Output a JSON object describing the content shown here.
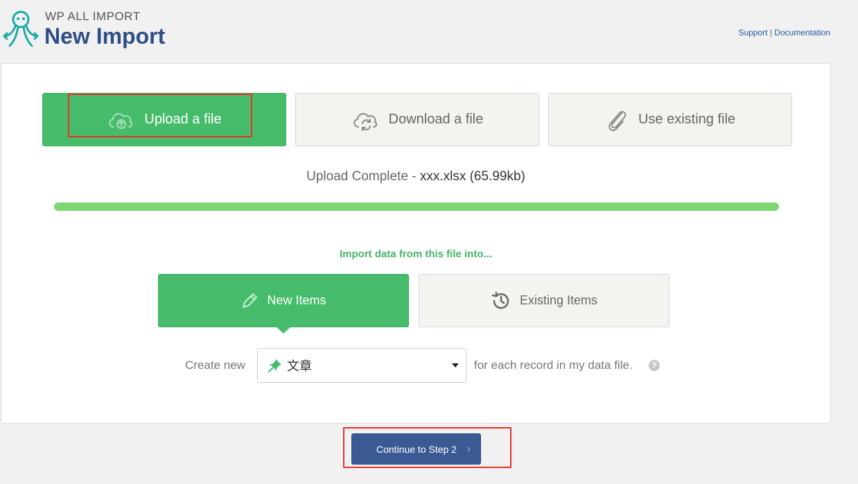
{
  "header": {
    "brand": "WP ALL IMPORT",
    "title": "New Import",
    "links": {
      "support": "Support",
      "separator": "|",
      "documentation": "Documentation"
    }
  },
  "sources": [
    {
      "label": "Upload a file",
      "icon": "cloud-upload-icon",
      "active": true
    },
    {
      "label": "Download a file",
      "icon": "cloud-sync-icon",
      "active": false
    },
    {
      "label": "Use existing file",
      "icon": "paperclip-icon",
      "active": false
    }
  ],
  "upload": {
    "status": "Upload Complete",
    "separator": " - ",
    "filename": "xxx.xlsx (65.99kb)",
    "progress_percent": 100
  },
  "import_into": {
    "prompt": "Import data from this file into...",
    "options": [
      {
        "label": "New Items",
        "icon": "pencil-icon",
        "active": true
      },
      {
        "label": "Existing Items",
        "icon": "history-icon",
        "active": false
      }
    ]
  },
  "create_new": {
    "label": "Create new",
    "selected": "文章",
    "suffix": "for each record in my data file.",
    "help": "?"
  },
  "continue_button": {
    "label": "Continue to Step 2",
    "chevron": "›"
  },
  "colors": {
    "green": "#46bc6b",
    "progress": "#7ed672",
    "navy": "#3b5a94",
    "title": "#2e4f86",
    "highlight": "#e8302a"
  }
}
